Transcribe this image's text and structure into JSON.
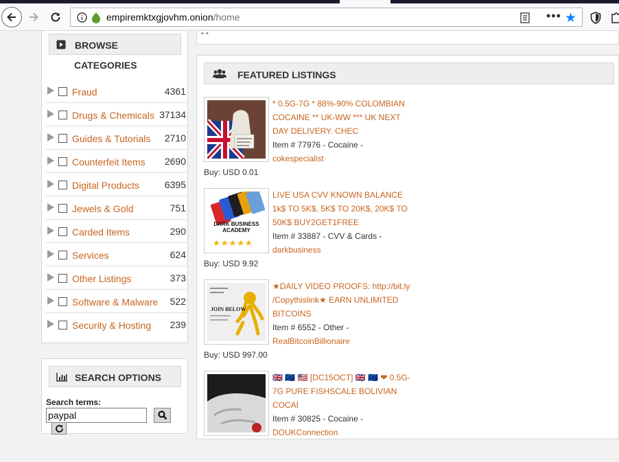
{
  "browser": {
    "url_domain": "empiremktxgjovhm.onion",
    "url_path": "/home"
  },
  "sidebar": {
    "browse_title": "BROWSE",
    "categories_title": "CATEGORIES",
    "categories": [
      {
        "label": "Fraud",
        "count": "4361"
      },
      {
        "label": "Drugs & Chemicals",
        "count": "37134"
      },
      {
        "label": "Guides & Tutorials",
        "count": "2710"
      },
      {
        "label": "Counterfeit Items",
        "count": "2690"
      },
      {
        "label": "Digital Products",
        "count": "6395"
      },
      {
        "label": "Jewels & Gold",
        "count": "751"
      },
      {
        "label": "Carded Items",
        "count": "290"
      },
      {
        "label": "Services",
        "count": "624"
      },
      {
        "label": "Other Listings",
        "count": "373"
      },
      {
        "label": "Software & Malware",
        "count": "522"
      },
      {
        "label": "Security & Hosting",
        "count": "239"
      }
    ],
    "search_title": "SEARCH OPTIONS",
    "search_terms_label": "Search terms:",
    "search_value": "paypal"
  },
  "main": {
    "featured_title": "FEATURED LISTINGS",
    "listings": [
      {
        "title": "* 0.5G-7G * 88%-90% COLOMBIAN COCAINE ** UK-WW *** UK NEXT DAY DELIVERY. CHEC",
        "item": "Item # 77976 - Cocaine -",
        "vendor": "cokespecialist",
        "price": "Buy: USD 0.01"
      },
      {
        "title": "LIVE USA CVV KNOWN BALANCE 1k$ TO 5K$, 5K$ TO 20K$, 20K$ TO 50K$ BUY2GET1FREE",
        "item": "Item # 33887 - CVV & Cards -",
        "vendor": "darkbusiness",
        "price": "Buy: USD 9.92",
        "image_text": "DARK BUSINESS ACADEMY"
      },
      {
        "title": "★DAILY VIDEO PROOFS: http://bit.ly /Copythislink★ EARN UNLIMITED BITCOINS",
        "item": "Item # 6552 - Other -",
        "vendor": "RealBitcoinBillionaire",
        "price": "Buy: USD 997.00",
        "image_text": "JOIN BELOW"
      },
      {
        "title": "🇬🇧 🇪🇺 🇺🇸 [DC15OCT] 🇬🇧 🇪🇺 ❤ 0.5G-7G PURE FISHSCALE BOLIVIAN COCAI",
        "item": "Item # 30825 - Cocaine -",
        "vendor": "DOUKConnection",
        "price": ""
      }
    ]
  },
  "colors": {
    "link": "#c8641e",
    "header_bg": "#eeeeee",
    "star": "#0a84ff"
  }
}
